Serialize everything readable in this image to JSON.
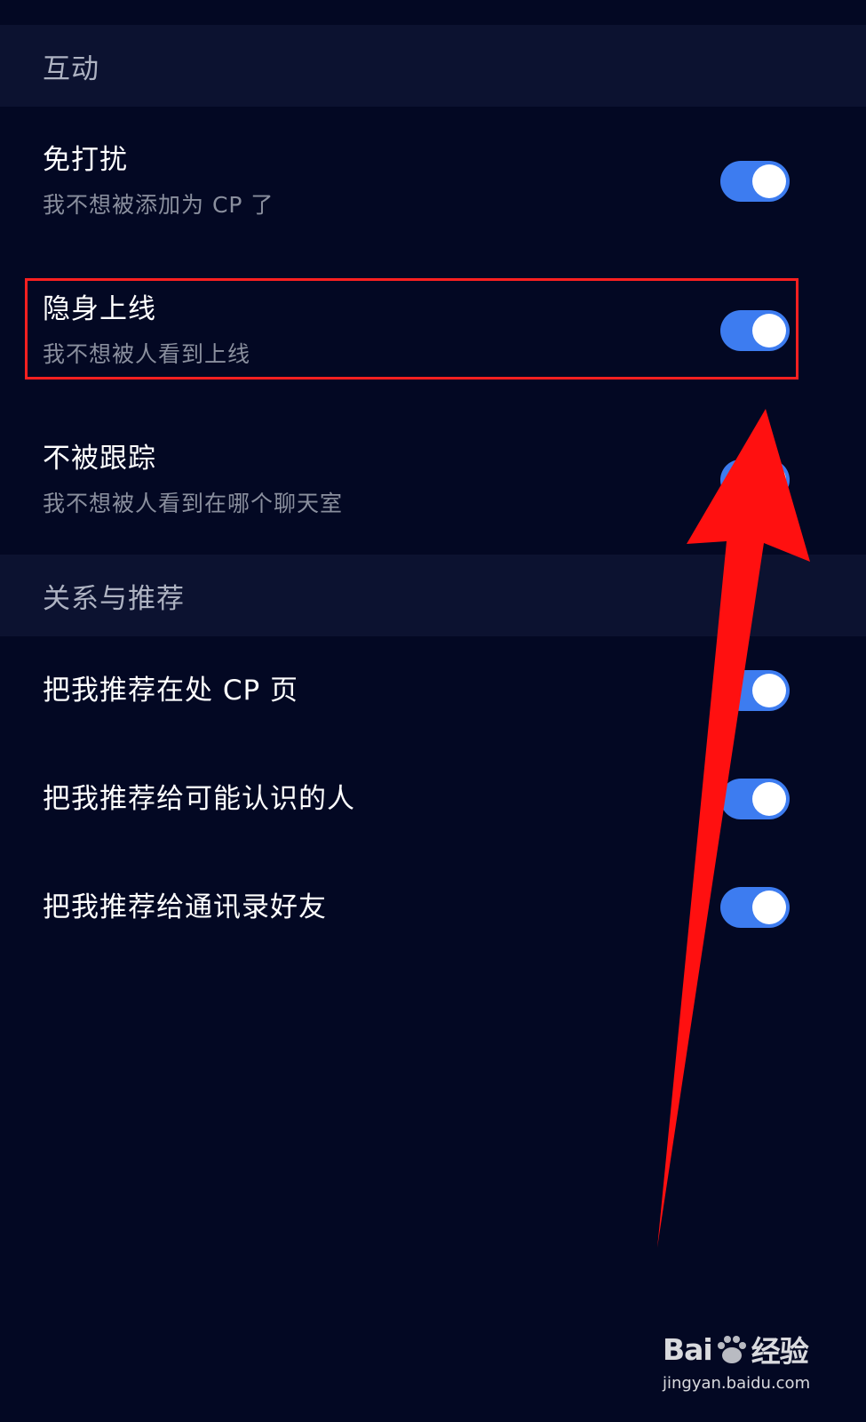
{
  "sections": [
    {
      "header": "互动",
      "rows": [
        {
          "title": "免打扰",
          "subtitle": "我不想被添加为 CP 了",
          "toggle": "on"
        },
        {
          "title": "隐身上线",
          "subtitle": "我不想被人看到上线",
          "toggle": "on"
        },
        {
          "title": "不被跟踪",
          "subtitle": "我不想被人看到在哪个聊天室",
          "toggle": "on"
        }
      ]
    },
    {
      "header": "关系与推荐",
      "rows": [
        {
          "title": "把我推荐在处 CP 页",
          "toggle": "on"
        },
        {
          "title": "把我推荐给可能认识的人",
          "toggle": "on"
        },
        {
          "title": "把我推荐给通讯录好友",
          "toggle": "on"
        }
      ]
    }
  ],
  "watermark": {
    "logo_left": "Bai",
    "logo_right": "经验",
    "url": "jingyan.baidu.com"
  },
  "colors": {
    "background": "#030823",
    "section_header_bg": "#0c1230",
    "toggle_on": "#3d7cf0",
    "annotation": "#ff2020"
  }
}
